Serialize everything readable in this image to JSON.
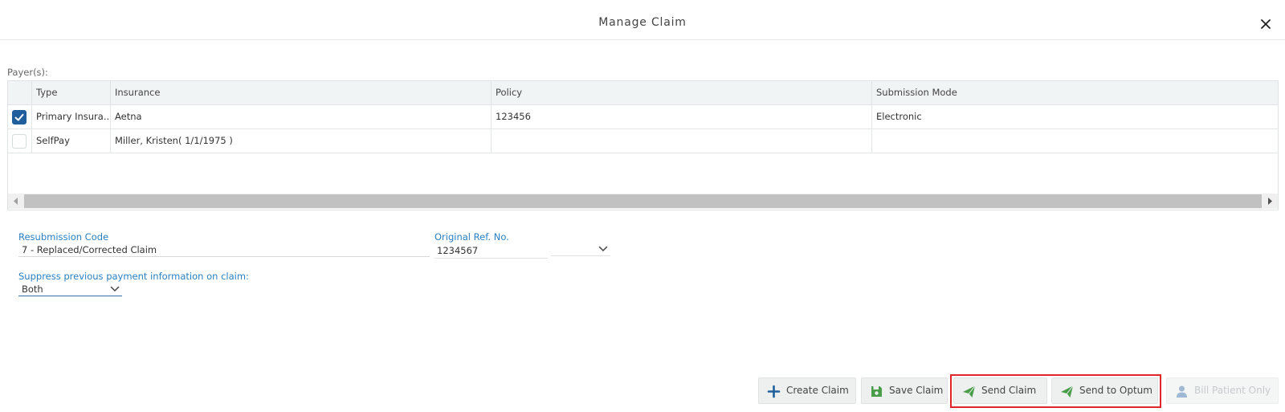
{
  "dialog": {
    "title": "Manage Claim",
    "close_icon": "close-icon"
  },
  "payers": {
    "label": "Payer(s):",
    "columns": [
      "Type",
      "Insurance",
      "Policy",
      "Submission Mode"
    ],
    "rows": [
      {
        "checked": true,
        "type": "Primary Insura...",
        "insurance": "Aetna",
        "policy": "123456",
        "submission_mode": "Electronic"
      },
      {
        "checked": false,
        "type": "SelfPay",
        "insurance": "Miller, Kristen( 1/1/1975 )",
        "policy": "",
        "submission_mode": ""
      }
    ]
  },
  "form": {
    "resubmission_code": {
      "label": "Resubmission Code",
      "value": "7 - Replaced/Corrected Claim"
    },
    "original_ref": {
      "label": "Original Ref. No.",
      "value": "1234567"
    },
    "suppress": {
      "label": "Suppress previous payment information on claim:",
      "value": "Both"
    }
  },
  "actions": {
    "create_claim": "Create Claim",
    "save_claim": "Save Claim",
    "send_claim": "Send Claim",
    "send_to_optum": "Send to Optum",
    "bill_patient_only": "Bill Patient Only"
  },
  "colors": {
    "accent_blue": "#2b7fc0",
    "checkbox_blue": "#1f5f9c",
    "send_green": "#4a9e4a",
    "highlight_red": "#e0262b"
  }
}
